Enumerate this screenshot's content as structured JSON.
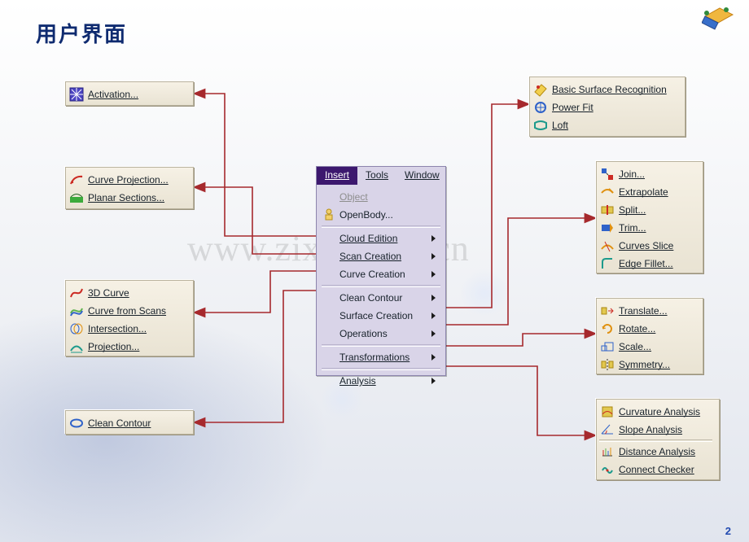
{
  "title": "用户界面",
  "page_number": "2",
  "watermark": "www.zixin.com.cn",
  "menu": {
    "menubar": {
      "insert": "Insert",
      "tools": "Tools",
      "window": "Window",
      "active": "insert"
    },
    "object": "Object",
    "openbody": "OpenBody...",
    "items": {
      "cloud_edition": "Cloud Edition",
      "scan_creation": "Scan Creation",
      "curve_creation": "Curve Creation",
      "clean_contour": "Clean Contour",
      "surface_creation": "Surface Creation",
      "operations": "Operations",
      "transformations": "Transformations",
      "analysis": "Analysis"
    }
  },
  "panels": {
    "activation": {
      "activation": "Activation..."
    },
    "scan": {
      "curve_projection": "Curve Projection...",
      "planar_sections": "Planar Sections..."
    },
    "curve": {
      "threed_curve": "3D Curve",
      "curve_from_scans": "Curve from Scans",
      "intersection": "Intersection...",
      "projection": "Projection..."
    },
    "clean": {
      "clean_contour": "Clean Contour"
    },
    "surface": {
      "basic": "Basic Surface Recognition",
      "power_fit": "Power Fit",
      "loft": "Loft"
    },
    "operations": {
      "join": "Join...",
      "extrapolate": "Extrapolate",
      "split": "Split...",
      "trim": "Trim...",
      "curves_slice": "Curves Slice",
      "edge_fillet": "Edge Fillet..."
    },
    "transformations": {
      "translate": "Translate...",
      "rotate": "Rotate...",
      "scale": "Scale...",
      "symmetry": "Symmetry..."
    },
    "analysis": {
      "curvature": "Curvature Analysis",
      "slope": "Slope Analysis",
      "distance": "Distance Analysis",
      "connect": "Connect Checker"
    }
  }
}
